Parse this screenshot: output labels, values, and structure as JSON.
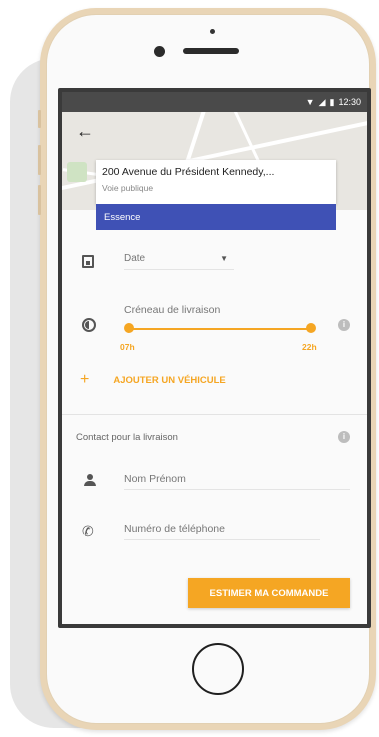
{
  "status_bar": {
    "time": "12:30"
  },
  "address": {
    "title": "200 Avenue du Président Kennedy,...",
    "subtitle": "Voie publique"
  },
  "fuel": {
    "label": "Essence",
    "color": "#3f51b5"
  },
  "date": {
    "placeholder": "Date"
  },
  "delivery_slot": {
    "label": "Créneau de livraison",
    "min_label": "07h",
    "max_label": "22h"
  },
  "add_vehicle": {
    "label": "AJOUTER UN VÉHICULE"
  },
  "contact": {
    "section_label": "Contact pour la livraison",
    "name_placeholder": "Nom Prénom",
    "phone_placeholder": "Numéro de téléphone"
  },
  "estimate_button": {
    "label": "ESTIMER MA COMMANDE"
  },
  "colors": {
    "accent": "#f5a623",
    "primary": "#3f51b5",
    "phone_frame": "#e9d5b6"
  },
  "icons": [
    "back-arrow-icon",
    "calendar-icon",
    "timelapse-icon",
    "info-icon",
    "plus-icon",
    "person-icon",
    "phone-icon",
    "wifi-icon",
    "signal-icon",
    "battery-icon"
  ]
}
